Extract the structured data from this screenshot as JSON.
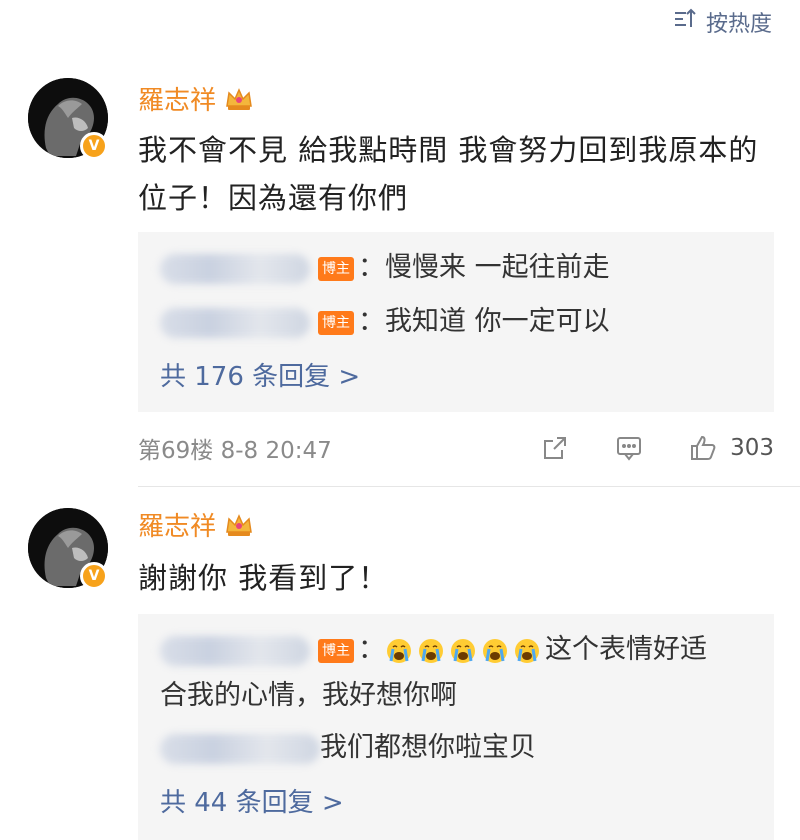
{
  "sort": {
    "label": "按热度"
  },
  "comments": [
    {
      "author": "羅志祥",
      "text": "我不會不見 給我點時間 我會努力回到我原本的位子！因為還有你們",
      "replies": [
        {
          "tag": "博主",
          "text": "：慢慢来 一起往前走"
        },
        {
          "tag": "博主",
          "text": "：我知道 你一定可以"
        }
      ],
      "more_replies": "共 176 条回复 >",
      "floor": "第69楼 8-8 20:47",
      "like_count": "303"
    },
    {
      "author": "羅志祥",
      "text": "謝謝你 我看到了！",
      "replies": [
        {
          "tag": "博主",
          "text_line1": "这个表情好适",
          "text_line2": "合我的心情，我好想你啊",
          "emoji_count": 5
        },
        {
          "text": "我们都想你啦宝贝"
        }
      ],
      "more_replies": "共 44 条回复 >"
    }
  ],
  "colors": {
    "author_name": "#f08a24",
    "link_blue": "#4e6a9e",
    "reply_bg": "#f5f5f5",
    "v_badge": "#f7a21b",
    "host_tag": "#ff7a1a"
  },
  "icons": [
    "sort-icon",
    "crown-icon",
    "v-badge-icon",
    "share-icon",
    "comment-icon",
    "thumbs-up-icon",
    "crying-emoji-icon"
  ]
}
